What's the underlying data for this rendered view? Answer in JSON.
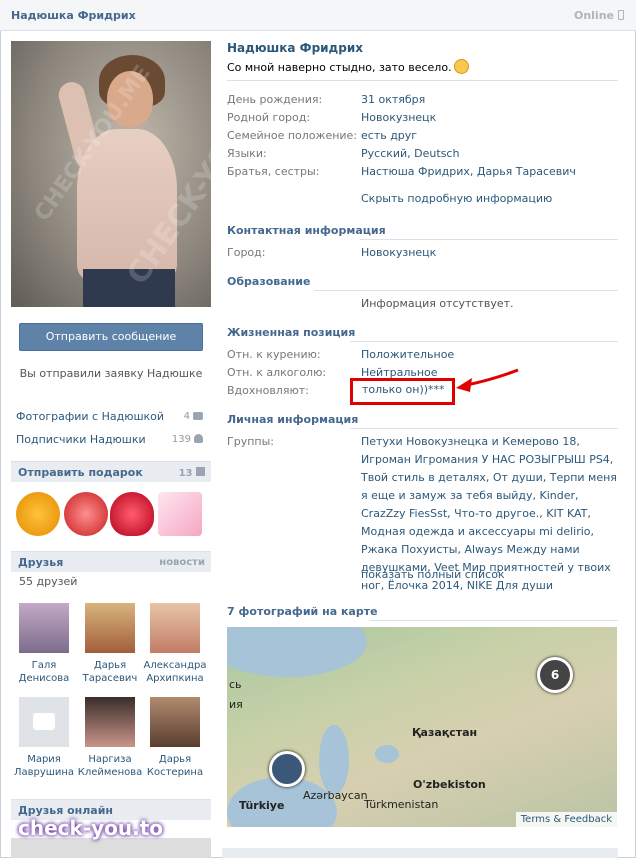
{
  "header": {
    "name": "Надюшка Фридрих",
    "online": "Online"
  },
  "profile": {
    "name": "Надюшка Фридрих",
    "status": "Со мной наверно стыдно, зато весело.",
    "fields": [
      {
        "label": "День рождения:",
        "value": "31 октября"
      },
      {
        "label": "Родной город:",
        "value": "Новокузнецк"
      },
      {
        "label": "Семейное положение:",
        "value": "есть друг"
      },
      {
        "label": "Языки:",
        "value": "Русский, Deutsch"
      },
      {
        "label": "Братья, сестры:",
        "value": "Настюша Фридрих, Дарья Тарасевич"
      }
    ],
    "hide_details": "Скрыть подробную информацию"
  },
  "contacts": {
    "title": "Контактная информация",
    "city_label": "Город:",
    "city_value": "Новокузнецк"
  },
  "education": {
    "title": "Образование",
    "none": "Информация отсутствует."
  },
  "life": {
    "title": "Жизненная позиция",
    "smoking_label": "Отн. к курению:",
    "smoking_value": "Положительное",
    "alcohol_label": "Отн. к алкоголю:",
    "alcohol_value": "Нейтральное",
    "inspire_label": "Вдохновляют:",
    "inspire_value": "только он))***"
  },
  "personal": {
    "title": "Личная информация",
    "groups_label": "Группы:",
    "groups_text": "Петухи Новокузнецка и Кемерово 18, Игроман Игромания У НАС РОЗЫГРЫШ PS4, Твой стиль в деталях, От души, Терпи меня я еще и замуж за тебя выйду, Kinder, CrazZzy FiesSst, Что-то другое., KIT KAT, Модная одежда и аксессуары mi delirio, Ржака Похуисты, Always Между нами девушками, Veet Мир приятностей у твоих ног, Ёлочка 2014, NIKE Для души",
    "show_all": "показать полный список"
  },
  "map": {
    "title": "7 фотографий на карте",
    "labels": [
      "Қазақстан",
      "O'zbekiston",
      "Türkiye",
      "Azərbaycan",
      "Türkmenistan",
      "сь",
      "ия"
    ],
    "pin_count": "6",
    "terms": "Terms & Feedback"
  },
  "left": {
    "send_message": "Отправить сообщение",
    "sent_request": "Вы отправили заявку Надюшке",
    "photos_link": "Фотографии с Надюшкой",
    "photos_count": "4",
    "subscribers_link": "Подписчики Надюшки",
    "subscribers_count": "139",
    "gift_title": "Отправить подарок",
    "gift_count": "13",
    "friends_title": "Друзья",
    "friends_news": "новости",
    "friends_count": "55 друзей",
    "friends": [
      {
        "first": "Галя",
        "last": "Денисова"
      },
      {
        "first": "Дарья",
        "last": "Тарасевич"
      },
      {
        "first": "Александра",
        "last": "Архипкина"
      },
      {
        "first": "Мария",
        "last": "Лаврушина"
      },
      {
        "first": "Наргиза",
        "last": "Клейменова"
      },
      {
        "first": "Дарья",
        "last": "Костерина"
      }
    ],
    "friends_online_title": "Друзья онлайн"
  },
  "watermarks": {
    "photo": "CHECK-YOU.ME",
    "bottom": "check-you.to"
  },
  "colors": {
    "link": "#2b587a",
    "header": "#45688e",
    "button": "#5e82a8",
    "annotation": "#e00000"
  }
}
